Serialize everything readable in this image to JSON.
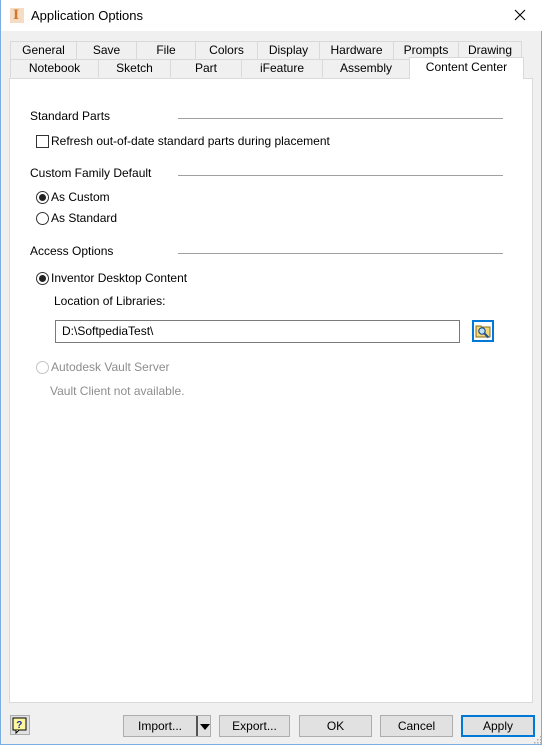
{
  "window": {
    "title": "Application Options",
    "close_icon": "close-icon",
    "app_icon": "inventor-app-icon",
    "app_icon_glyph": "I"
  },
  "tabs": {
    "row1": [
      {
        "label": "General"
      },
      {
        "label": "Save"
      },
      {
        "label": "File"
      },
      {
        "label": "Colors"
      },
      {
        "label": "Display"
      },
      {
        "label": "Hardware"
      },
      {
        "label": "Prompts"
      },
      {
        "label": "Drawing"
      }
    ],
    "row2": [
      {
        "label": "Notebook"
      },
      {
        "label": "Sketch"
      },
      {
        "label": "Part"
      },
      {
        "label": "iFeature"
      },
      {
        "label": "Assembly"
      },
      {
        "label": "Content Center",
        "active": true
      }
    ]
  },
  "content": {
    "standard_parts": {
      "heading": "Standard Parts",
      "refresh_checkbox": {
        "label": "Refresh out-of-date standard parts during placement",
        "checked": false
      }
    },
    "custom_family_default": {
      "heading": "Custom Family Default",
      "options": [
        {
          "label": "As Custom",
          "checked": true
        },
        {
          "label": "As Standard",
          "checked": false
        }
      ]
    },
    "access_options": {
      "heading": "Access Options",
      "desktop_content": {
        "label": "Inventor Desktop Content",
        "checked": true
      },
      "location_label": "Location of Libraries:",
      "location_value": "D:\\SoftpediaTest\\",
      "browse_icon": "folder-search-icon",
      "vault_server": {
        "label": "Autodesk Vault Server",
        "checked": false,
        "disabled": true
      },
      "vault_note": "Vault Client not available."
    }
  },
  "footer": {
    "help_icon": "help-icon",
    "import_label": "Import...",
    "export_label": "Export...",
    "ok_label": "OK",
    "cancel_label": "Cancel",
    "apply_label": "Apply"
  },
  "colors": {
    "accent": "#0078d7",
    "window_border": "#7aaee0",
    "disabled_text": "#8d8d8d",
    "app_icon": "#d2782e"
  }
}
